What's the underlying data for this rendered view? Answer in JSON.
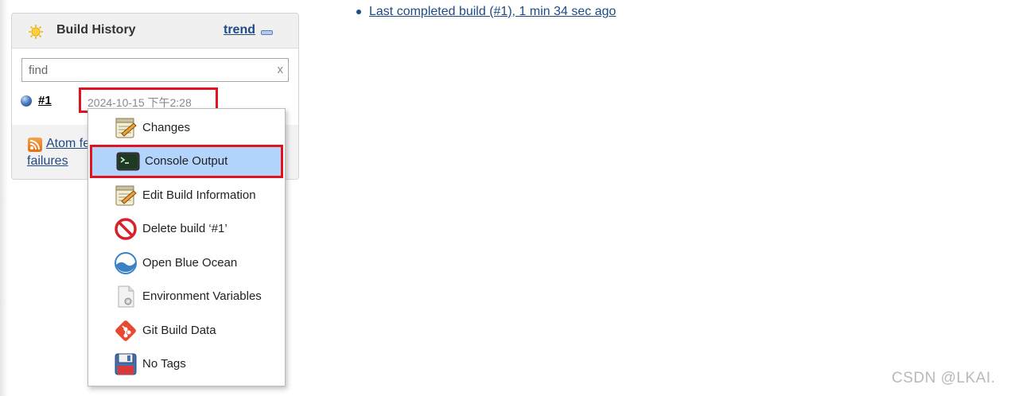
{
  "build_history": {
    "title": "Build History",
    "trend_label": "trend",
    "search": {
      "placeholder": "find",
      "clear_label": "x"
    },
    "builds": [
      {
        "number": "#1",
        "date": "2024-10-15 下午2:28"
      }
    ],
    "footer": {
      "atom_label": "Atom fe",
      "failures_label": "failures"
    }
  },
  "top_links": {
    "last_completed": "Last completed build (#1), 1 min 34 sec ago"
  },
  "context_menu": {
    "items": [
      {
        "label": "Changes",
        "icon": "notepad-icon"
      },
      {
        "label": "Console Output",
        "icon": "terminal-icon",
        "selected": true
      },
      {
        "label": "Edit Build Information",
        "icon": "notepad-icon"
      },
      {
        "label": "Delete build ‘#1’",
        "icon": "no-entry-icon"
      },
      {
        "label": "Open Blue Ocean",
        "icon": "blue-ocean-icon"
      },
      {
        "label": "Environment Variables",
        "icon": "document-gear-icon"
      },
      {
        "label": "Git Build Data",
        "icon": "git-icon"
      },
      {
        "label": "No Tags",
        "icon": "floppy-disk-icon"
      }
    ]
  },
  "watermark": "CSDN @LKAI.",
  "colors": {
    "link": "#204a87",
    "highlight_border": "#e0141e",
    "selected_bg": "#b3d4fc"
  }
}
